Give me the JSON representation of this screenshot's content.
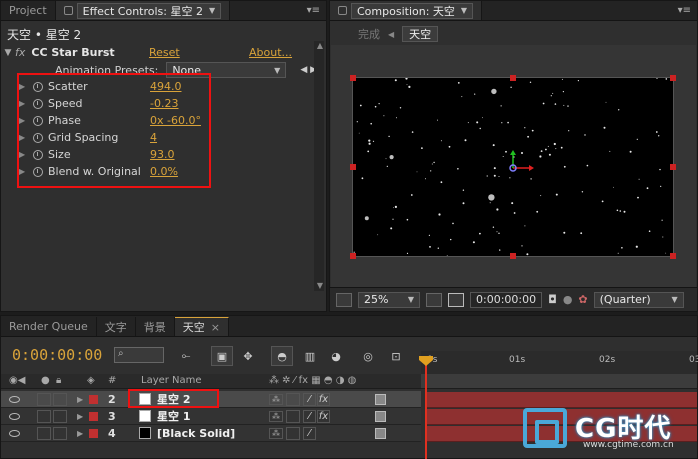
{
  "effect_controls_panel": {
    "project_tab": "Project",
    "tab_label": "Effect Controls: 星空 2",
    "layer_title": "天空 • 星空 2",
    "effect": {
      "name": "CC Star Burst",
      "reset": "Reset",
      "about": "About...",
      "presets_label": "Animation Presets:",
      "presets_value": "None"
    },
    "properties": [
      {
        "name": "Scatter",
        "value": "494.0"
      },
      {
        "name": "Speed",
        "value": "-0.23"
      },
      {
        "name": "Phase",
        "value": "0x -60.0°"
      },
      {
        "name": "Grid Spacing",
        "value": "4"
      },
      {
        "name": "Size",
        "value": "93.0"
      },
      {
        "name": "Blend w. Original",
        "value": "0.0%"
      }
    ]
  },
  "composition_panel": {
    "tab_label": "Composition: 天空",
    "crumb_done": "完成",
    "crumb_current": "天空",
    "zoom": "25%",
    "timecode": "0:00:00:00",
    "resolution": "(Quarter)"
  },
  "timeline_panel": {
    "tabs": [
      "Render Queue",
      "文字",
      "背景",
      "天空"
    ],
    "timecode": "0:00:00:00",
    "column_headers": {
      "number": "#",
      "layer_name": "Layer Name"
    },
    "ruler_marks": [
      "0s",
      "01s",
      "02s",
      "03"
    ],
    "layers": [
      {
        "number": "2",
        "name": "星空 2",
        "swatch": "#ffffff",
        "selected": true,
        "has_fx": true
      },
      {
        "number": "3",
        "name": "星空 1",
        "swatch": "#ffffff",
        "selected": false,
        "has_fx": true
      },
      {
        "number": "4",
        "name": "[Black Solid]",
        "swatch": "#000000",
        "selected": false,
        "has_fx": false
      }
    ]
  },
  "watermark": {
    "brand": "CG时代",
    "url": "www.cgtime.com.cn"
  },
  "colors": {
    "accent": "#d9a33a",
    "highlight_box": "#e11111",
    "layer_label": "#c03030",
    "playhead": "#e03020"
  }
}
